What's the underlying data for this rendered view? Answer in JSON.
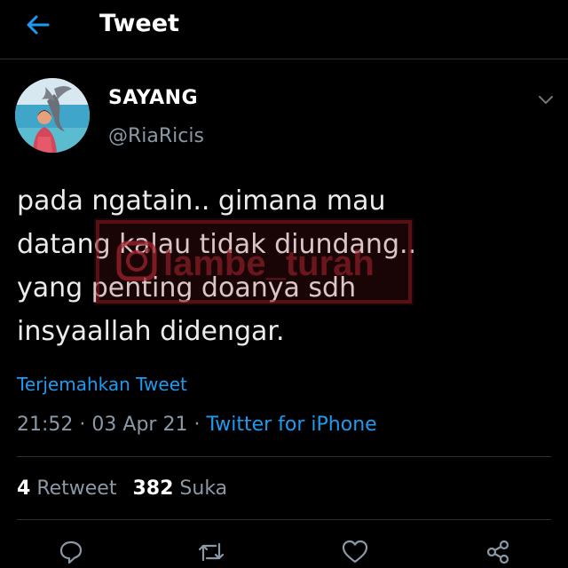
{
  "header": {
    "title": "Tweet",
    "back_icon": "arrow-left-icon",
    "accent_color": "#1d9bf0"
  },
  "author": {
    "name": "SAYANG",
    "handle": "@RiaRicis",
    "more_icon": "chevron-down-icon"
  },
  "tweet": {
    "text": "pada ngatain.. gimana mau\ndatang kalau tidak diundang..\nyang penting doanya sdh\ninsyaallah didengar.",
    "translate_label": "Terjemahkan Tweet",
    "time": "21:52",
    "separator": "·",
    "date": "03 Apr 21",
    "source": "Twitter for iPhone"
  },
  "watermark": {
    "text": "@lambe_turah",
    "color": "#8b1a22"
  },
  "stats": {
    "retweets_count": "4",
    "retweets_label": "Retweet",
    "likes_count": "382",
    "likes_label": "Suka"
  },
  "actions": [
    "reply-icon",
    "retweet-icon",
    "like-icon",
    "share-icon"
  ],
  "colors": {
    "background": "#000000",
    "text_primary": "#ffffff",
    "text_secondary": "#8b98a5",
    "link": "#1d9bf0",
    "divider": "#2a2d31"
  }
}
